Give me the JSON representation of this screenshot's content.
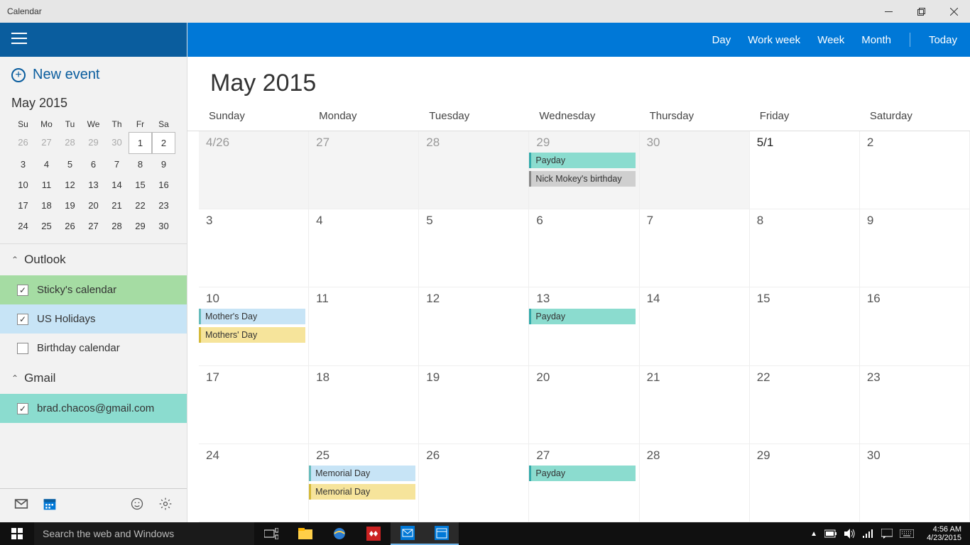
{
  "window": {
    "title": "Calendar"
  },
  "toolbar": {
    "views": {
      "day": "Day",
      "workweek": "Work week",
      "week": "Week",
      "month": "Month",
      "today": "Today"
    }
  },
  "sidebar": {
    "new_event": "New event",
    "mini_month_title": "May 2015",
    "day_abbrev": [
      "Su",
      "Mo",
      "Tu",
      "We",
      "Th",
      "Fr",
      "Sa"
    ],
    "mini_days": [
      {
        "n": "26",
        "o": true
      },
      {
        "n": "27",
        "o": true
      },
      {
        "n": "28",
        "o": true
      },
      {
        "n": "29",
        "o": true
      },
      {
        "n": "30",
        "o": true
      },
      {
        "n": "1",
        "s": true
      },
      {
        "n": "2",
        "s": true
      },
      {
        "n": "3"
      },
      {
        "n": "4"
      },
      {
        "n": "5"
      },
      {
        "n": "6"
      },
      {
        "n": "7"
      },
      {
        "n": "8"
      },
      {
        "n": "9"
      },
      {
        "n": "10"
      },
      {
        "n": "11"
      },
      {
        "n": "12"
      },
      {
        "n": "13"
      },
      {
        "n": "14"
      },
      {
        "n": "15"
      },
      {
        "n": "16"
      },
      {
        "n": "17"
      },
      {
        "n": "18"
      },
      {
        "n": "19"
      },
      {
        "n": "20"
      },
      {
        "n": "21"
      },
      {
        "n": "22"
      },
      {
        "n": "23"
      },
      {
        "n": "24"
      },
      {
        "n": "25"
      },
      {
        "n": "26"
      },
      {
        "n": "27"
      },
      {
        "n": "28"
      },
      {
        "n": "29"
      },
      {
        "n": "30"
      }
    ],
    "accounts": [
      {
        "name": "Outlook",
        "cals": [
          {
            "label": "Sticky's calendar",
            "cls": "sticky",
            "checked": true
          },
          {
            "label": "US Holidays",
            "cls": "holidays",
            "checked": true
          },
          {
            "label": "Birthday calendar",
            "cls": "",
            "checked": false
          }
        ]
      },
      {
        "name": "Gmail",
        "cals": [
          {
            "label": "brad.chacos@gmail.com",
            "cls": "gmail",
            "checked": true
          }
        ]
      }
    ]
  },
  "main": {
    "title": "May 2015",
    "day_names": [
      "Sunday",
      "Monday",
      "Tuesday",
      "Wednesday",
      "Thursday",
      "Friday",
      "Saturday"
    ],
    "weeks": [
      [
        {
          "label": "4/26",
          "other": true
        },
        {
          "label": "27",
          "other": true
        },
        {
          "label": "28",
          "other": true
        },
        {
          "label": "29",
          "other": true,
          "events": [
            {
              "t": "Payday",
              "c": "teal"
            },
            {
              "t": "Nick Mokey's birthday",
              "c": "gray"
            }
          ]
        },
        {
          "label": "30",
          "other": true
        },
        {
          "label": "5/1",
          "first": true
        },
        {
          "label": "2"
        }
      ],
      [
        {
          "label": "3"
        },
        {
          "label": "4"
        },
        {
          "label": "5"
        },
        {
          "label": "6"
        },
        {
          "label": "7"
        },
        {
          "label": "8"
        },
        {
          "label": "9"
        }
      ],
      [
        {
          "label": "10",
          "events": [
            {
              "t": "Mother's Day",
              "c": "blue"
            },
            {
              "t": "Mothers' Day",
              "c": "yellow"
            }
          ]
        },
        {
          "label": "11"
        },
        {
          "label": "12"
        },
        {
          "label": "13",
          "events": [
            {
              "t": "Payday",
              "c": "teal"
            }
          ]
        },
        {
          "label": "14"
        },
        {
          "label": "15"
        },
        {
          "label": "16"
        }
      ],
      [
        {
          "label": "17"
        },
        {
          "label": "18"
        },
        {
          "label": "19"
        },
        {
          "label": "20"
        },
        {
          "label": "21"
        },
        {
          "label": "22"
        },
        {
          "label": "23"
        }
      ],
      [
        {
          "label": "24"
        },
        {
          "label": "25",
          "events": [
            {
              "t": "Memorial Day",
              "c": "blue"
            },
            {
              "t": "Memorial Day",
              "c": "yellow"
            }
          ]
        },
        {
          "label": "26"
        },
        {
          "label": "27",
          "events": [
            {
              "t": "Payday",
              "c": "teal"
            }
          ]
        },
        {
          "label": "28"
        },
        {
          "label": "29"
        },
        {
          "label": "30"
        }
      ]
    ]
  },
  "taskbar": {
    "search_placeholder": "Search the web and Windows",
    "time": "4:56 AM",
    "date": "4/23/2015"
  }
}
